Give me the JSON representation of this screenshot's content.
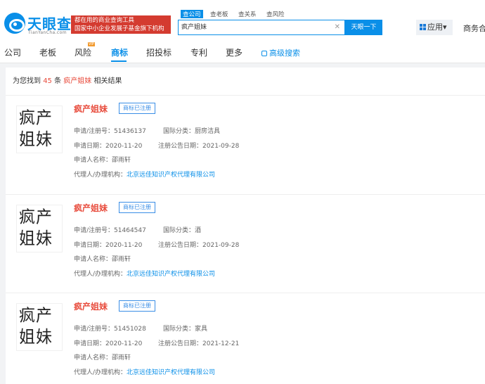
{
  "header": {
    "logo_text": "天眼查",
    "logo_sub": "TianYanCha.com",
    "slogan_line1": "都在用的商业查询工具",
    "slogan_line2": "国家中小企业发展子基金旗下机构",
    "search_tabs": [
      "查公司",
      "查老板",
      "查关系",
      "查风险"
    ],
    "search_value": "疯产姐妹",
    "search_button": "天眼一下",
    "app_button": "应用▾",
    "biz_link": "商务合作"
  },
  "nav": {
    "items": [
      "公司",
      "老板",
      "风险",
      "商标",
      "招投标",
      "专利",
      "更多"
    ],
    "advanced": "高级搜索",
    "vip": "VIP"
  },
  "summary": {
    "prefix": "为您找到",
    "count": "45",
    "unit": "条",
    "keyword": "疯产姐妹",
    "suffix": "相关结果"
  },
  "labels": {
    "reg_no": "申请/注册号：",
    "intl_class": "国际分类：",
    "apply_date": "申请日期：",
    "pub_date": "注册公告日期：",
    "applicant": "申请人名称：",
    "agent": "代理人/办理机构："
  },
  "results": [
    {
      "image_text": "疯产姐妹",
      "name": "疯产姐妹",
      "status": "商标已注册",
      "reg_no": "51436137",
      "intl_class": "厨房洁具",
      "apply_date": "2020-11-20",
      "pub_date": "2021-09-28",
      "applicant": "邵雨轩",
      "agent": "北京远佳知识产权代理有限公司"
    },
    {
      "image_text": "疯产姐妹",
      "name": "疯产姐妹",
      "status": "商标已注册",
      "reg_no": "51464547",
      "intl_class": "酒",
      "apply_date": "2020-11-20",
      "pub_date": "2021-09-28",
      "applicant": "邵雨轩",
      "agent": "北京远佳知识产权代理有限公司"
    },
    {
      "image_text": "疯产姐妹",
      "name": "疯产姐妹",
      "status": "商标已注册",
      "reg_no": "51451028",
      "intl_class": "家具",
      "apply_date": "2020-11-20",
      "pub_date": "2021-12-21",
      "applicant": "邵雨轩",
      "agent": "北京远佳知识产权代理有限公司"
    }
  ],
  "colors": {
    "brand_blue": "#0a8fe8",
    "highlight_red": "#e84c3d",
    "slogan_red": "#d43b30"
  }
}
